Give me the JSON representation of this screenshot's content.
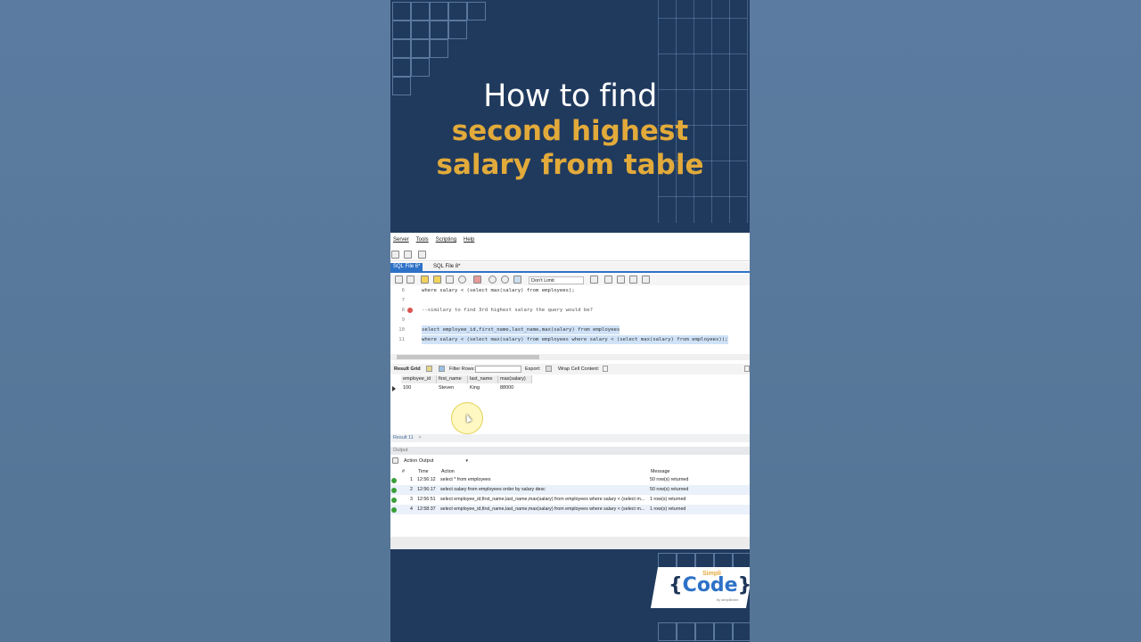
{
  "title": {
    "line1": "How to find",
    "line2": "second highest",
    "line3": "salary from table"
  },
  "workbench": {
    "menu": [
      "Server",
      "Tools",
      "Scripting",
      "Help"
    ],
    "tabs": [
      "SQL File 6*",
      "SQL File 8*"
    ],
    "limit_select": "Don't Limit",
    "code_lines": [
      {
        "num": "6",
        "text": "where salary < (select max(salary) from employees);"
      },
      {
        "num": "7",
        "text": ""
      },
      {
        "num": "8",
        "text": "--similary to find 3rd highest salary the query would be?"
      },
      {
        "num": "9",
        "text": ""
      },
      {
        "num": "10",
        "text": "select employee_id,first_name,last_name,max(salary) from employees"
      },
      {
        "num": "11",
        "text": "where salary < (select max(salary) from employees where salary < (select max(salary) from employees));"
      }
    ],
    "result_toolbar": {
      "result_grid": "Result Grid",
      "filter_rows": "Filter Rows:",
      "export": "Export:",
      "wrap": "Wrap Cell Content:"
    },
    "grid": {
      "columns": [
        "employee_id",
        "first_name",
        "last_name",
        "max(salary)"
      ],
      "rows": [
        [
          "100",
          "Steven",
          "King",
          "88000"
        ]
      ]
    },
    "result_tab": "Result 11",
    "output_label": "Output",
    "output_select": "Action Output",
    "output_columns": [
      "#",
      "Time",
      "Action",
      "Message"
    ],
    "output_rows": [
      {
        "num": "1",
        "time": "12:56:12",
        "action": "select * from employees",
        "message": "50 row(s) returned"
      },
      {
        "num": "2",
        "time": "12:56:17",
        "action": "select salary from employees order by salary desc",
        "message": "50 row(s) returned"
      },
      {
        "num": "3",
        "time": "12:56:51",
        "action": "select employee_id,first_name,last_name,max(salary) from employees where salary < (select m...",
        "message": "1 row(s) returned"
      },
      {
        "num": "4",
        "time": "12:58:37",
        "action": "select employee_id,first_name,last_name,max(salary) from employees where salary < (select m...",
        "message": "1 row(s) returned"
      }
    ]
  },
  "logo": {
    "simpli": "Simpli",
    "code": "Code",
    "by": "by simplilearn"
  },
  "colors": {
    "card_bg": "#203a5e",
    "accent_gold": "#e2aa3a",
    "side_bg": "#59789c",
    "tab_blue": "#2e72c7"
  }
}
